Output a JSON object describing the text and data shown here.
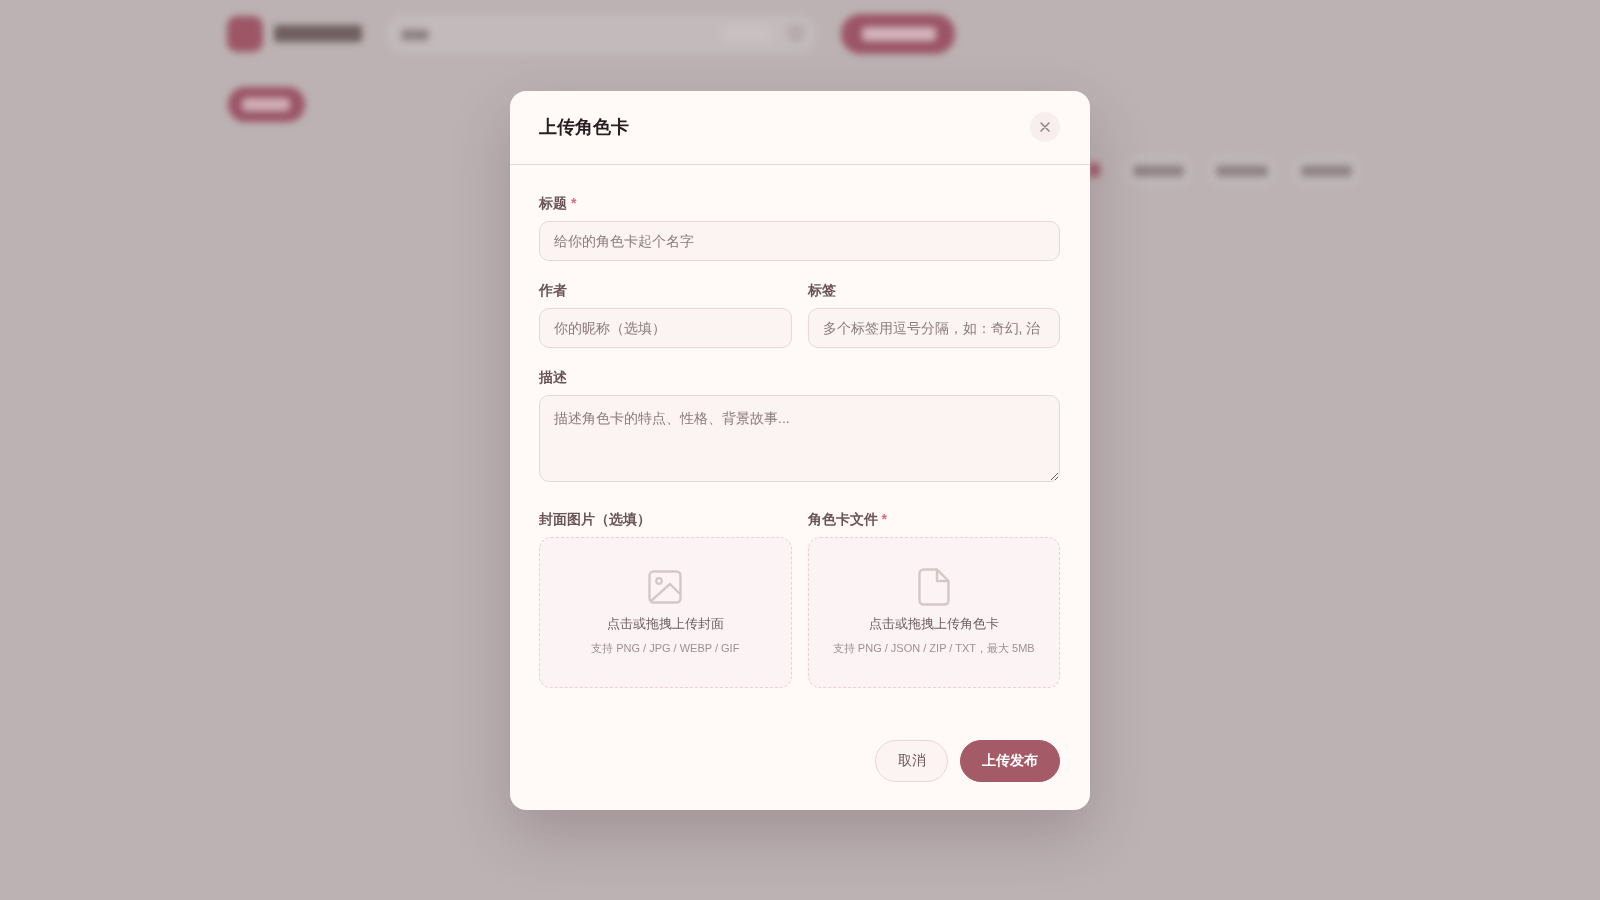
{
  "dialog": {
    "title": "上传角色卡",
    "rows": [
      {
        "fields": [
          {
            "kind": "input",
            "label": "标题",
            "required_mark": "*",
            "placeholder": "给你的角色卡起个名字"
          }
        ]
      },
      {
        "fields": [
          {
            "kind": "input",
            "label": "作者",
            "placeholder": "你的昵称（选填）"
          },
          {
            "kind": "input",
            "label": "标签",
            "placeholder": "多个标签用逗号分隔，如：奇幻, 治"
          }
        ]
      },
      {
        "fields": [
          {
            "kind": "textarea",
            "label": "描述",
            "placeholder": "描述角色卡的特点、性格、背景故事..."
          }
        ]
      },
      {
        "fields": [
          {
            "kind": "image_upload",
            "label": "封面图片（选填）",
            "prompt": "点击或拖拽上传封面",
            "hint": "支持 PNG / JPG / WEBP / GIF"
          },
          {
            "kind": "file_upload",
            "label": "角色卡文件",
            "required_mark": "*",
            "prompt": "点击或拖拽上传角色卡",
            "hint": "支持 PNG / JSON / ZIP / TXT，最大 5MB"
          }
        ]
      }
    ],
    "buttons": [
      {
        "kind": "secondary",
        "label": "取消"
      },
      {
        "kind": "primary",
        "label": "上传发布"
      }
    ]
  }
}
